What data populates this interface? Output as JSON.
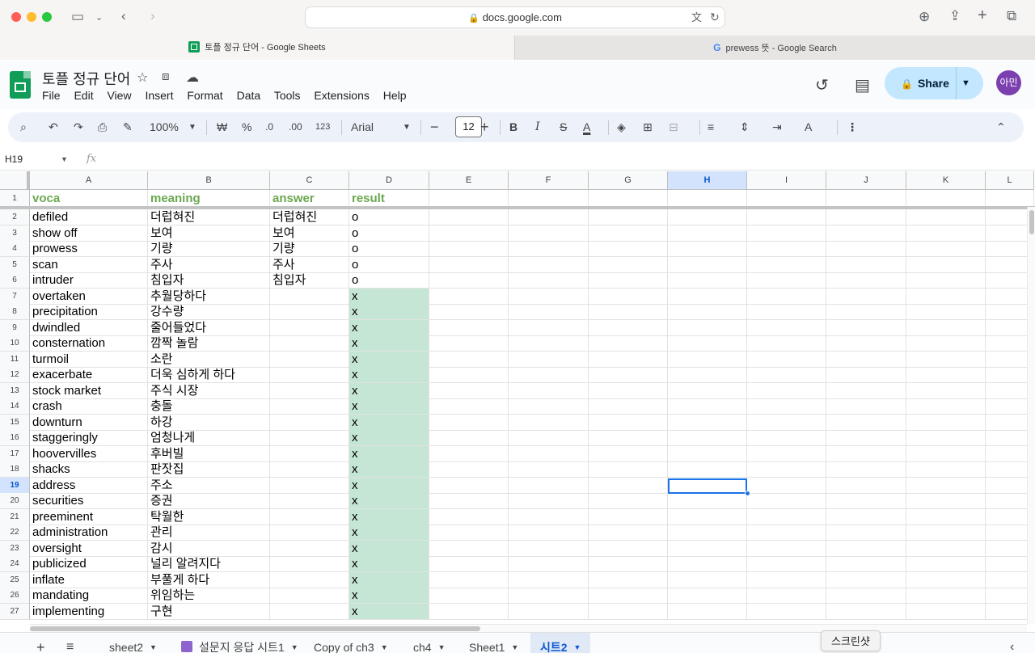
{
  "browser": {
    "url": "docs.google.com",
    "tabs": [
      {
        "title": "토플 정규 단어 - Google Sheets"
      },
      {
        "title": "prewess 뜻 - Google Search"
      }
    ]
  },
  "doc": {
    "title": "토플 정규 단어",
    "menu": [
      "File",
      "Edit",
      "View",
      "Insert",
      "Format",
      "Data",
      "Tools",
      "Extensions",
      "Help"
    ],
    "share_label": "Share",
    "avatar_text": "아민"
  },
  "toolbar": {
    "zoom": "100%",
    "currency": "₩",
    "percent": "%",
    "dec_decrease": ".0",
    "dec_increase": ".00",
    "number_format": "123",
    "font": "Arial",
    "font_size": "12"
  },
  "formula_bar": {
    "cell_ref": "H19",
    "fx": "fx"
  },
  "grid": {
    "columns": [
      "A",
      "B",
      "C",
      "D",
      "E",
      "F",
      "G",
      "H",
      "I",
      "J",
      "K",
      "L"
    ],
    "selected_column": "H",
    "selected_row": "19",
    "header_row": {
      "num": "1",
      "cells": [
        "voca",
        "meaning",
        "answer",
        "result"
      ]
    },
    "rows": [
      {
        "num": "2",
        "voca": "defiled",
        "meaning": "더럽혀진",
        "answer": "더럽혀진",
        "result": "o"
      },
      {
        "num": "3",
        "voca": "show off",
        "meaning": "보여",
        "answer": "보여",
        "result": "o"
      },
      {
        "num": "4",
        "voca": "prowess",
        "meaning": "기량",
        "answer": "기량",
        "result": "o"
      },
      {
        "num": "5",
        "voca": "scan",
        "meaning": "주사",
        "answer": "주사",
        "result": "o"
      },
      {
        "num": "6",
        "voca": "intruder",
        "meaning": "침입자",
        "answer": "침입자",
        "result": "o"
      },
      {
        "num": "7",
        "voca": "overtaken",
        "meaning": "추월당하다",
        "answer": "",
        "result": "x"
      },
      {
        "num": "8",
        "voca": "precipitation",
        "meaning": "강수량",
        "answer": "",
        "result": "x"
      },
      {
        "num": "9",
        "voca": "dwindled",
        "meaning": "줄어들었다",
        "answer": "",
        "result": "x"
      },
      {
        "num": "10",
        "voca": "consternation",
        "meaning": "깜짝 놀람",
        "answer": "",
        "result": "x"
      },
      {
        "num": "11",
        "voca": "turmoil",
        "meaning": "소란",
        "answer": "",
        "result": "x"
      },
      {
        "num": "12",
        "voca": "exacerbate",
        "meaning": "더욱 심하게 하다",
        "answer": "",
        "result": "x"
      },
      {
        "num": "13",
        "voca": "stock market",
        "meaning": "주식 시장",
        "answer": "",
        "result": "x"
      },
      {
        "num": "14",
        "voca": "crash",
        "meaning": "충돌",
        "answer": "",
        "result": "x"
      },
      {
        "num": "15",
        "voca": "downturn",
        "meaning": "하강",
        "answer": "",
        "result": "x"
      },
      {
        "num": "16",
        "voca": "staggeringly",
        "meaning": "엄청나게",
        "answer": "",
        "result": "x"
      },
      {
        "num": "17",
        "voca": "hoovervilles",
        "meaning": "후버빌",
        "answer": "",
        "result": "x"
      },
      {
        "num": "18",
        "voca": "shacks",
        "meaning": "판잣집",
        "answer": "",
        "result": "x"
      },
      {
        "num": "19",
        "voca": "address",
        "meaning": "주소",
        "answer": "",
        "result": "x"
      },
      {
        "num": "20",
        "voca": "securities",
        "meaning": "증권",
        "answer": "",
        "result": "x"
      },
      {
        "num": "21",
        "voca": "preeminent",
        "meaning": "탁월한",
        "answer": "",
        "result": "x"
      },
      {
        "num": "22",
        "voca": "administration",
        "meaning": "관리",
        "answer": "",
        "result": "x"
      },
      {
        "num": "23",
        "voca": "oversight",
        "meaning": "감시",
        "answer": "",
        "result": "x"
      },
      {
        "num": "24",
        "voca": "publicized",
        "meaning": "널리 알려지다",
        "answer": "",
        "result": "x"
      },
      {
        "num": "25",
        "voca": "inflate",
        "meaning": "부풀게 하다",
        "answer": "",
        "result": "x"
      },
      {
        "num": "26",
        "voca": "mandating",
        "meaning": "위임하는",
        "answer": "",
        "result": "x"
      },
      {
        "num": "27",
        "voca": "implementing",
        "meaning": "구현",
        "answer": "",
        "result": "x"
      }
    ]
  },
  "sheet_tabs": {
    "tabs": [
      "sheet2",
      "설문지 응답 시트1",
      "Copy of ch3",
      "ch4",
      "Sheet1",
      "시트2"
    ],
    "active": "시트2"
  },
  "tooltip": "스크린샷",
  "colors": {
    "header_text": "#6aa84f",
    "wrong_fill": "#c5e6d4",
    "selection": "#1a73e8",
    "share_bg": "#c2e7ff"
  }
}
